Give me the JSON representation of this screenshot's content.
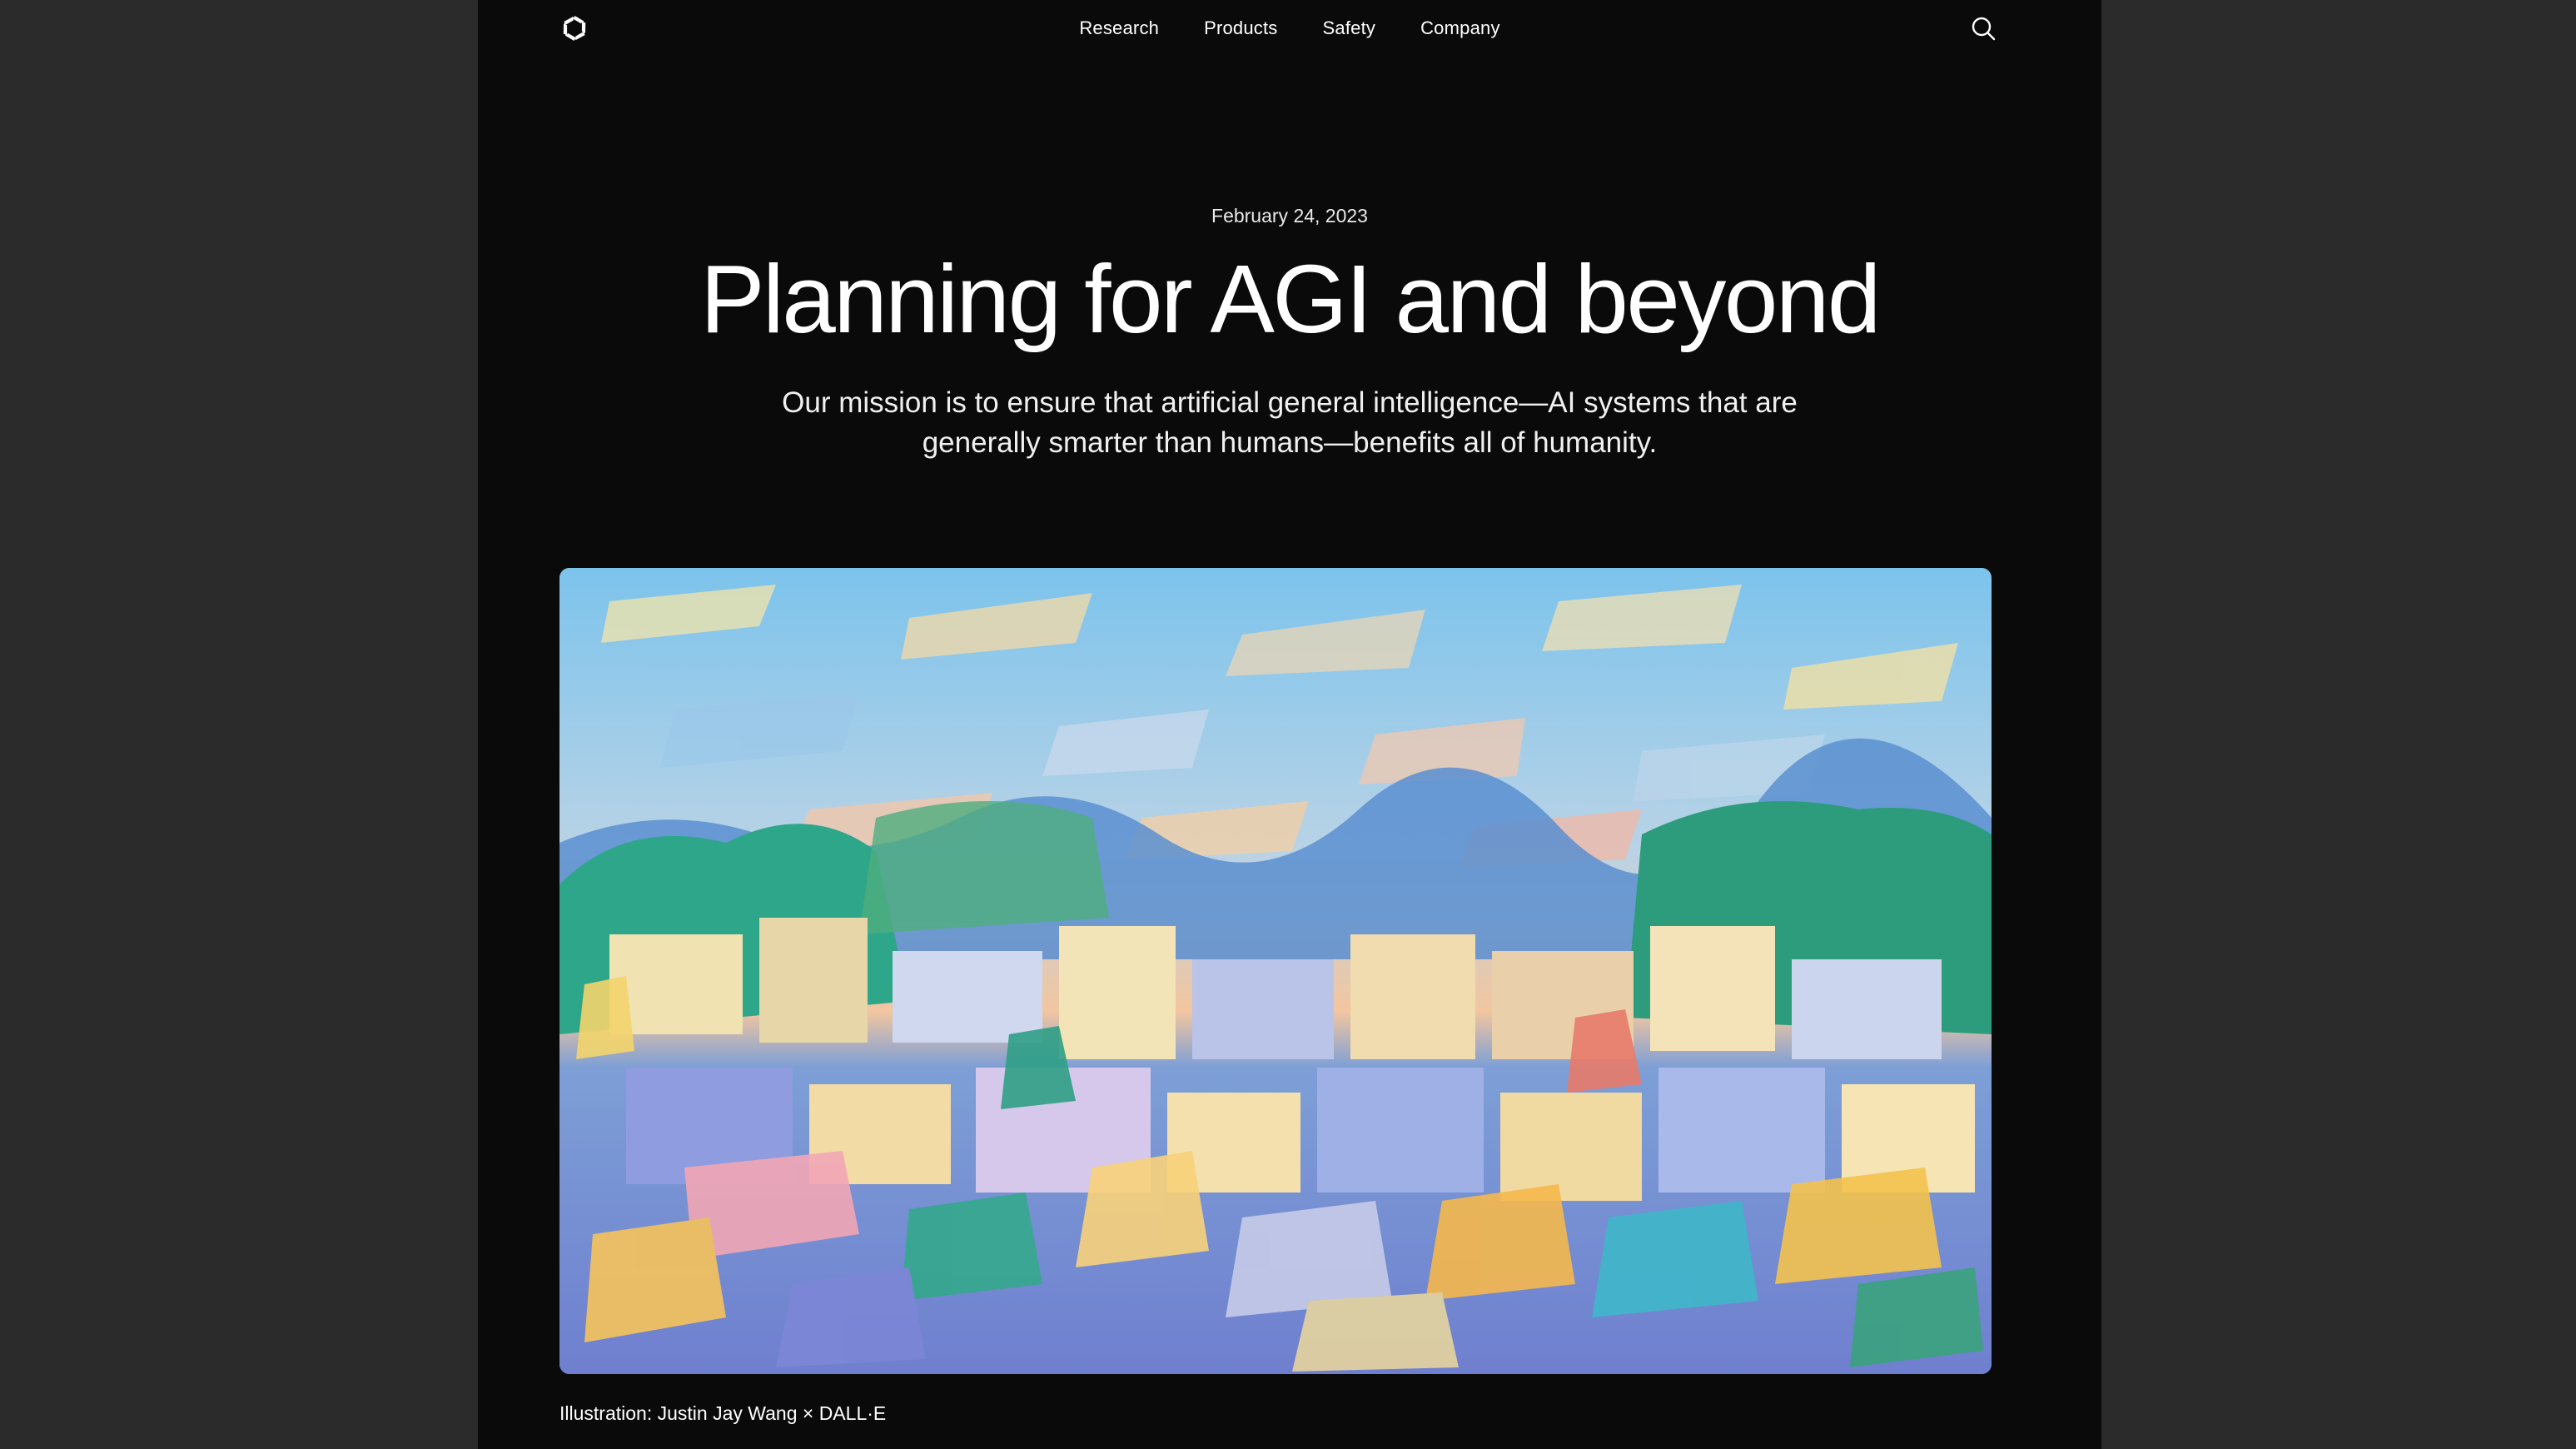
{
  "nav": {
    "logo_icon": "openai-logo-icon",
    "links": [
      "Research",
      "Products",
      "Safety",
      "Company"
    ],
    "search_icon": "search-icon"
  },
  "article": {
    "date": "February 24, 2023",
    "title": "Planning for AGI and beyond",
    "subtitle": "Our mission is to ensure that artificial general intelligence—AI systems that are generally smarter than humans—benefits all of humanity."
  },
  "illustration": {
    "caption": "Illustration: Justin Jay Wang × DALL·E"
  },
  "colors": {
    "page_background": "#0a0a0a",
    "outer_background": "#2b2b2b",
    "text": "#ffffff"
  }
}
